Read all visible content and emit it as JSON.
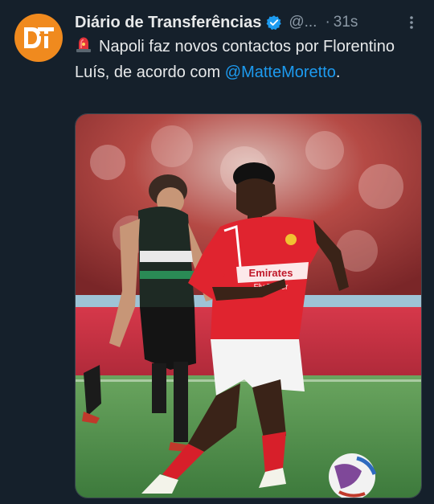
{
  "tweet": {
    "author_name": "Diário de Transferências",
    "handle": "@...",
    "separator": "·",
    "time": "31s",
    "text_main": "Napoli faz novos contactos por Florentino Luís, de acordo com ",
    "mention": "@MatteMoretto",
    "text_end": "."
  },
  "avatar": {
    "logo_letters": "DT",
    "color": "#f08a1e"
  },
  "media": {
    "kit_text_left": "Emirates",
    "kit_text_right": "Fly Better"
  },
  "icons": {
    "verified": "verified-badge-icon",
    "more": "more-options-icon",
    "siren": "siren-emoji-icon"
  },
  "colors": {
    "background": "#15202b",
    "text": "#e7e9ea",
    "secondary": "#8b98a5",
    "link": "#1d9bf0"
  }
}
